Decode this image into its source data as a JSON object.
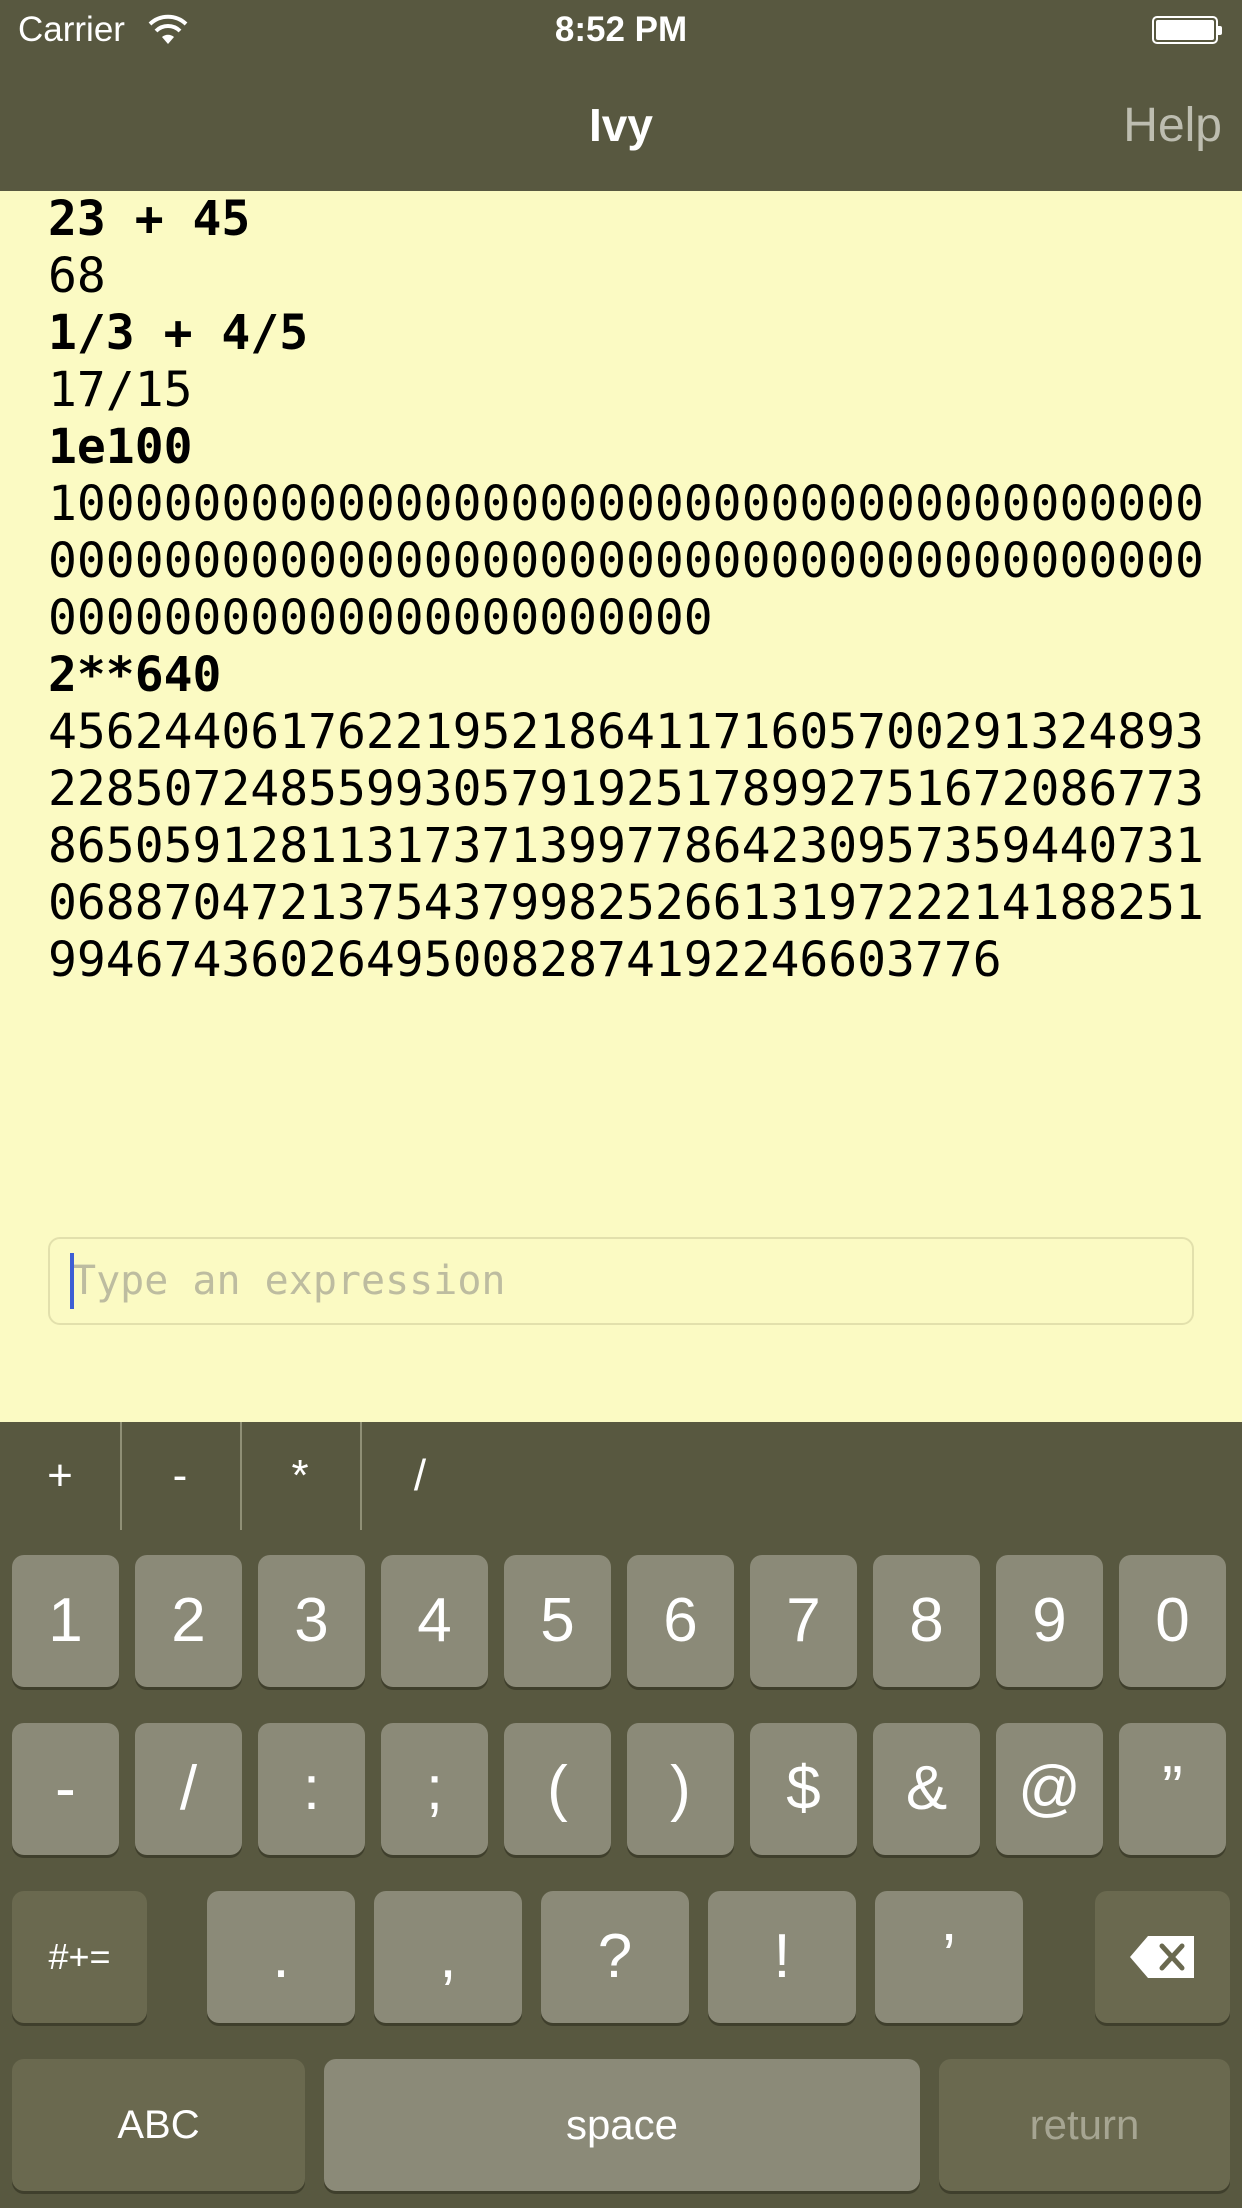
{
  "status_bar": {
    "carrier": "Carrier",
    "time": "8:52 PM"
  },
  "nav": {
    "title": "Ivy",
    "help_label": "Help"
  },
  "output": {
    "lines": [
      {
        "text": "23 + 45",
        "kind": "input"
      },
      {
        "text": "68",
        "kind": "result"
      },
      {
        "text": "1/3 + 4/5",
        "kind": "input"
      },
      {
        "text": "17/15",
        "kind": "result"
      },
      {
        "text": "1e100",
        "kind": "input"
      },
      {
        "text": "1000000000000000000000000000000000000000",
        "kind": "result"
      },
      {
        "text": "0000000000000000000000000000000000000000",
        "kind": "result"
      },
      {
        "text": "00000000000000000000000",
        "kind": "result"
      },
      {
        "text": "2**640",
        "kind": "input"
      },
      {
        "text": "4562440617622195218641171605700291324893",
        "kind": "result"
      },
      {
        "text": "2285072485599305791925178992751672086773",
        "kind": "result"
      },
      {
        "text": "8650591281131737139977864230957359440731",
        "kind": "result"
      },
      {
        "text": "0688704721375437998252661319722214188251",
        "kind": "result"
      },
      {
        "text": "99467436026495008287419224660377 6",
        "kind": "result"
      }
    ]
  },
  "input": {
    "placeholder": "Type an expression"
  },
  "accessory_keys": [
    "+",
    "-",
    "*",
    "/"
  ],
  "keyboard": {
    "row1": [
      "1",
      "2",
      "3",
      "4",
      "5",
      "6",
      "7",
      "8",
      "9",
      "0"
    ],
    "row2": [
      "-",
      "/",
      ":",
      ";",
      "(",
      ")",
      "$",
      "&",
      "@",
      "”"
    ],
    "row3": [
      ".",
      ",",
      "?",
      "!",
      "’"
    ],
    "more_symbols_label": "#+=",
    "abc_label": "ABC",
    "space_label": "space",
    "return_label": "return"
  },
  "colors": {
    "bar": "#585840",
    "background": "#fbfac3",
    "key": "#8b8a78",
    "key_dark": "#6a694f",
    "caret": "#3d5ed4"
  }
}
